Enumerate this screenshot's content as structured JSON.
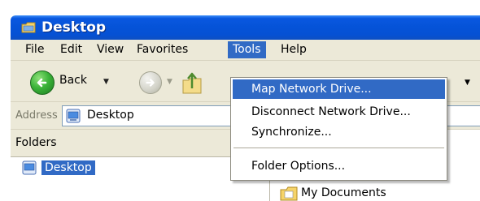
{
  "window": {
    "title": "Desktop"
  },
  "menubar": {
    "items": [
      {
        "label": "File",
        "active": false
      },
      {
        "label": "Edit",
        "active": false
      },
      {
        "label": "View",
        "active": false
      },
      {
        "label": "Favorites",
        "active": false
      },
      {
        "label": "Tools",
        "active": true
      },
      {
        "label": "Help",
        "active": false
      }
    ]
  },
  "toolbar": {
    "back_label": "Back"
  },
  "address": {
    "label": "Address",
    "value": "Desktop"
  },
  "folders": {
    "header": "Folders",
    "selected_item": "Desktop"
  },
  "content": {
    "items": [
      "My Documents"
    ]
  },
  "tools_menu": {
    "items": [
      {
        "label": "Map Network Drive...",
        "highlighted": true
      },
      {
        "label": "Disconnect Network Drive...",
        "highlighted": false
      },
      {
        "label": "Synchronize...",
        "highlighted": false
      },
      {
        "label": "Folder Options...",
        "highlighted": false
      }
    ]
  },
  "colors": {
    "titlebar": "#0553d8",
    "menu_highlight": "#316ac5",
    "window_face": "#ece9d8"
  }
}
